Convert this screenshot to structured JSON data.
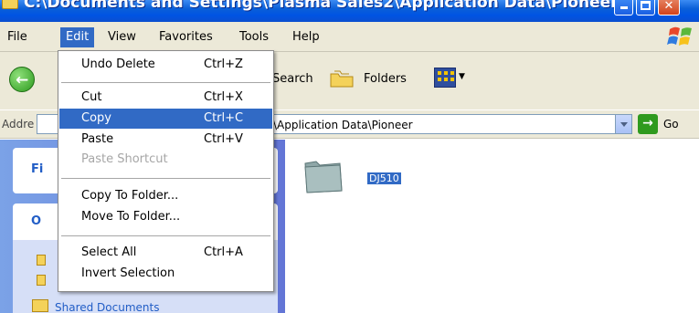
{
  "window": {
    "title": "C:\\Documents and Settings\\Plasma Sales2\\Application Data\\Pioneer",
    "min_label": "",
    "close_label": "✕"
  },
  "menubar": {
    "items": [
      {
        "label": "File"
      },
      {
        "label": "Edit",
        "active": true
      },
      {
        "label": "View"
      },
      {
        "label": "Favorites"
      },
      {
        "label": "Tools"
      },
      {
        "label": "Help"
      }
    ]
  },
  "toolbar": {
    "search_label": "Search",
    "folders_label": "Folders"
  },
  "address": {
    "label": "Addre",
    "value": "\\Application Data\\Pioneer",
    "go_label": "Go"
  },
  "taskpane": {
    "box1_label": "Fi",
    "box2_label": "O",
    "shared_label": "Shared Documents"
  },
  "content": {
    "folder_name": "DJ510"
  },
  "edit_menu": {
    "items": [
      {
        "label": "Undo Delete",
        "shortcut": "Ctrl+Z"
      },
      {
        "label": "Cut",
        "shortcut": "Ctrl+X"
      },
      {
        "label": "Copy",
        "shortcut": "Ctrl+C",
        "selected": true
      },
      {
        "label": "Paste",
        "shortcut": "Ctrl+V"
      },
      {
        "label": "Paste Shortcut",
        "shortcut": "",
        "disabled": true
      },
      {
        "label": "Copy To Folder...",
        "shortcut": ""
      },
      {
        "label": "Move To Folder...",
        "shortcut": ""
      },
      {
        "label": "Select All",
        "shortcut": "Ctrl+A"
      },
      {
        "label": "Invert Selection",
        "shortcut": ""
      }
    ]
  },
  "colors": {
    "title_bar": "#0054e3",
    "selection": "#316ac5",
    "menu_bg": "#ece9d8",
    "task_pane": "#6375d6"
  }
}
